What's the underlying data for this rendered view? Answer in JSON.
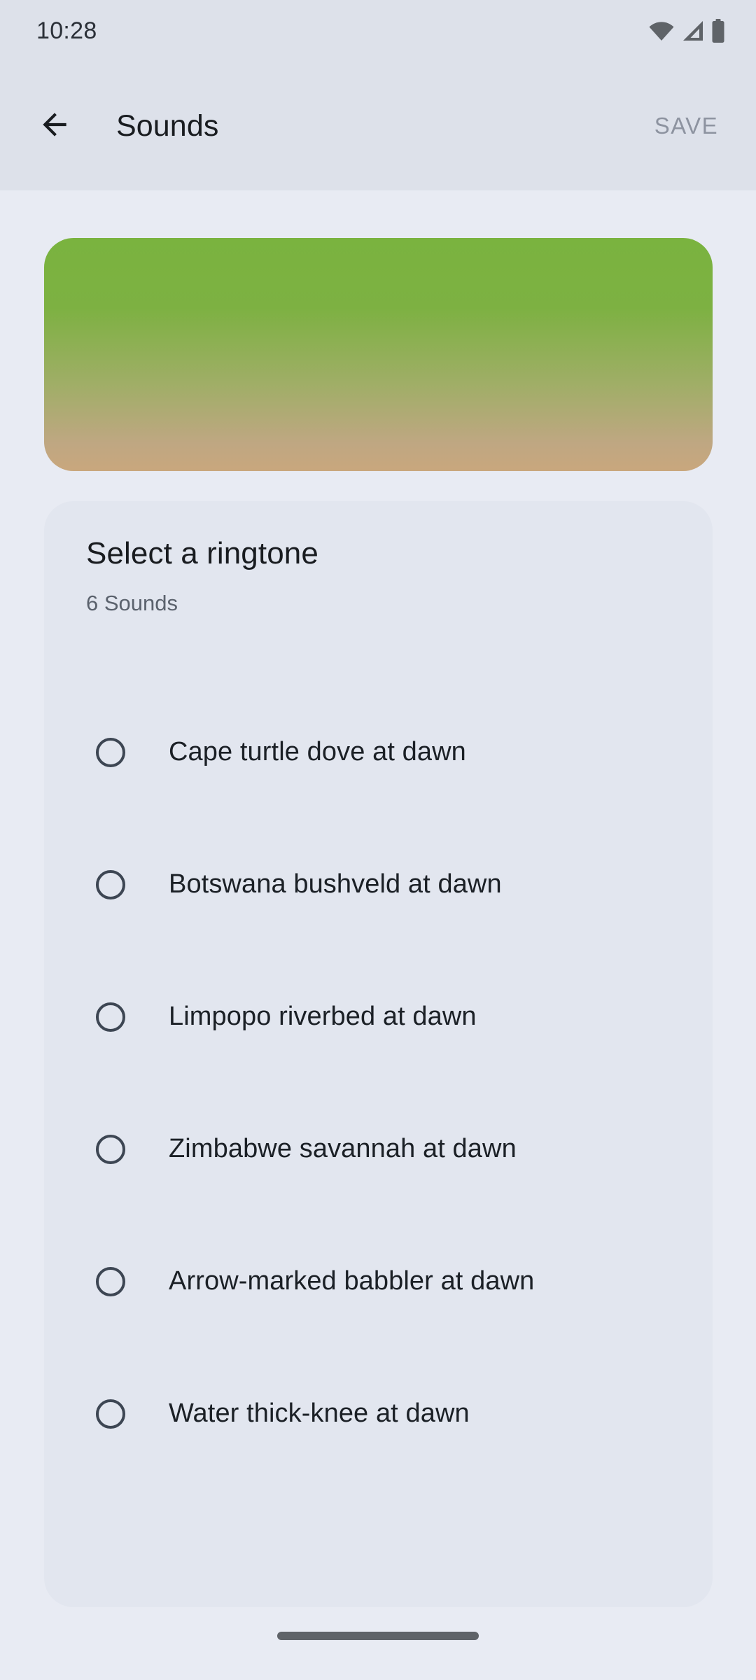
{
  "status_bar": {
    "time": "10:28",
    "icons": [
      {
        "name": "wifi-icon"
      },
      {
        "name": "cellular-signal-icon"
      },
      {
        "name": "battery-icon"
      }
    ]
  },
  "app_bar": {
    "back_icon": "arrow-back-icon",
    "title": "Sounds",
    "save_label": "SAVE",
    "save_enabled": false
  },
  "hero": {
    "gradient_top": "#7ab33f",
    "gradient_bottom": "#c9a77d"
  },
  "ringtone_section": {
    "title": "Select a ringtone",
    "subtitle": "6 Sounds",
    "options": [
      {
        "label": "Cape turtle dove at dawn",
        "selected": false
      },
      {
        "label": "Botswana bushveld at dawn",
        "selected": false
      },
      {
        "label": "Limpopo riverbed at dawn",
        "selected": false
      },
      {
        "label": "Zimbabwe savannah at dawn",
        "selected": false
      },
      {
        "label": "Arrow-marked babbler at dawn",
        "selected": false
      },
      {
        "label": "Water thick-knee at dawn",
        "selected": false
      }
    ]
  },
  "navigation_bar": {
    "home_handle": "home-gesture-handle"
  },
  "colors": {
    "page_background": "#e8ebf3",
    "app_bar_background": "#dde1ea",
    "card_background": "#e2e6ef",
    "text_primary": "#191c20",
    "text_secondary": "#5b626d",
    "save_disabled": "#8d93a0"
  }
}
